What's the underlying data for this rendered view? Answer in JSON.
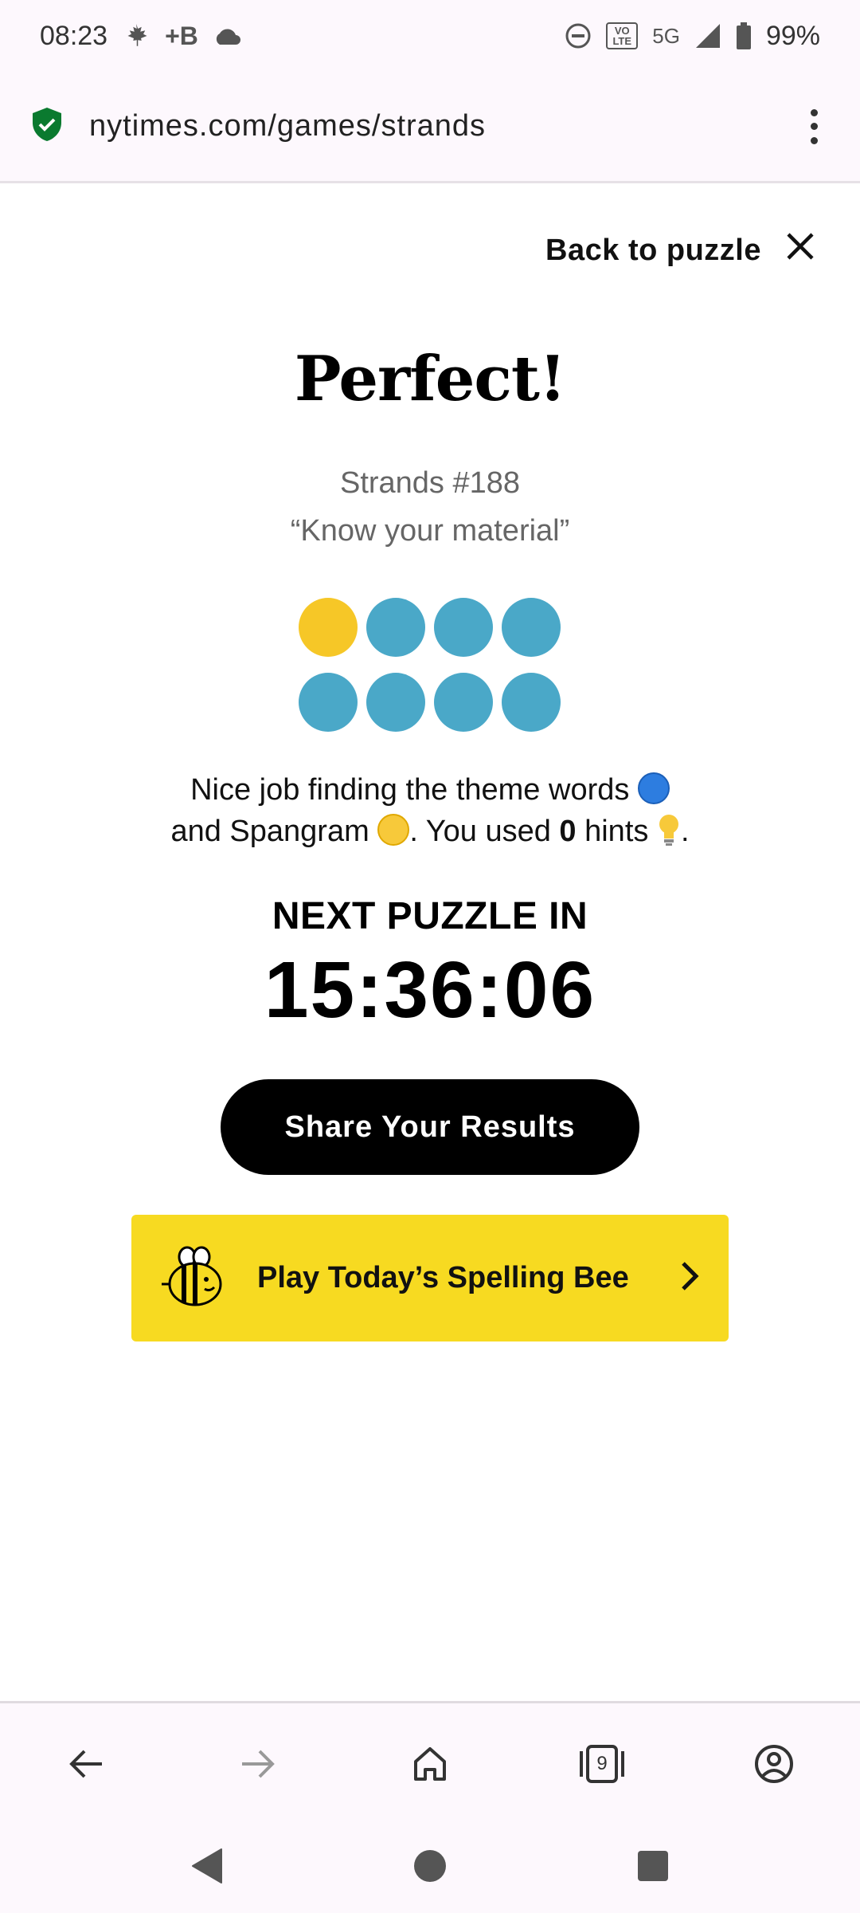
{
  "status_bar": {
    "time": "08:23",
    "icons_left": [
      "maple-leaf-icon",
      "plus-b-icon",
      "cloud-icon"
    ],
    "icons_right": [
      "dnd-icon",
      "volte-icon",
      "5g-icon",
      "signal-icon",
      "battery-icon"
    ],
    "battery": "99%",
    "plus_b_label": "+B",
    "network_label": "5G",
    "volte_label": "VO LTE"
  },
  "browser": {
    "url": "nytimes.com/games/strands"
  },
  "modal": {
    "back_label": "Back to puzzle",
    "headline": "Perfect!",
    "puzzle_number": "Strands #188",
    "puzzle_theme": "“Know your material”",
    "result_dots": [
      "spangram",
      "theme",
      "theme",
      "theme",
      "theme",
      "theme",
      "theme",
      "theme"
    ],
    "summary_line1": "Nice job finding the theme words",
    "summary_line2_a": "and Spangram",
    "summary_line2_b": ". You used",
    "hints_count": "0",
    "summary_line2_c": "hints",
    "summary_end": ".",
    "next_label": "NEXT PUZZLE IN",
    "countdown": "15:36:06",
    "share_label": "Share Your Results",
    "spelling_bee_label": "Play Today’s Spelling Bee"
  },
  "colors": {
    "theme_dot": "#4aa8c8",
    "spangram_dot": "#f6c727",
    "bee_banner": "#f7da21"
  },
  "bottom_nav": {
    "tab_count": "9",
    "items": [
      "back-arrow-icon",
      "forward-arrow-icon",
      "home-icon",
      "tabs-icon",
      "account-icon"
    ]
  }
}
